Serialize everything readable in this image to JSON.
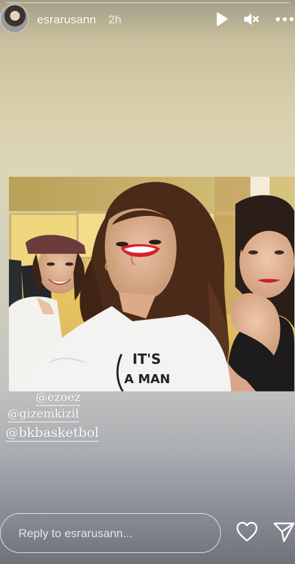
{
  "progress": {
    "fraction": 0
  },
  "header": {
    "username": "esrarusann",
    "timestamp": "2h",
    "avatar_icon": "profile-avatar",
    "play_icon": "play-icon",
    "mute_icon": "muted-speaker-icon",
    "more_icon": "more-dots-icon"
  },
  "mentions": [
    "@ezoez",
    "@gizemkizil",
    "@bkbasketbol"
  ],
  "reply": {
    "placeholder": "Reply to esrarusann...",
    "value": ""
  },
  "footer_icons": {
    "like": "heart-icon",
    "share": "send-icon"
  },
  "photo": {
    "shirt_text_line1": "IT'S",
    "shirt_text_line2": "A MAN"
  },
  "colors": {
    "text": "#ffffff",
    "lipstick": "#d8202a"
  }
}
